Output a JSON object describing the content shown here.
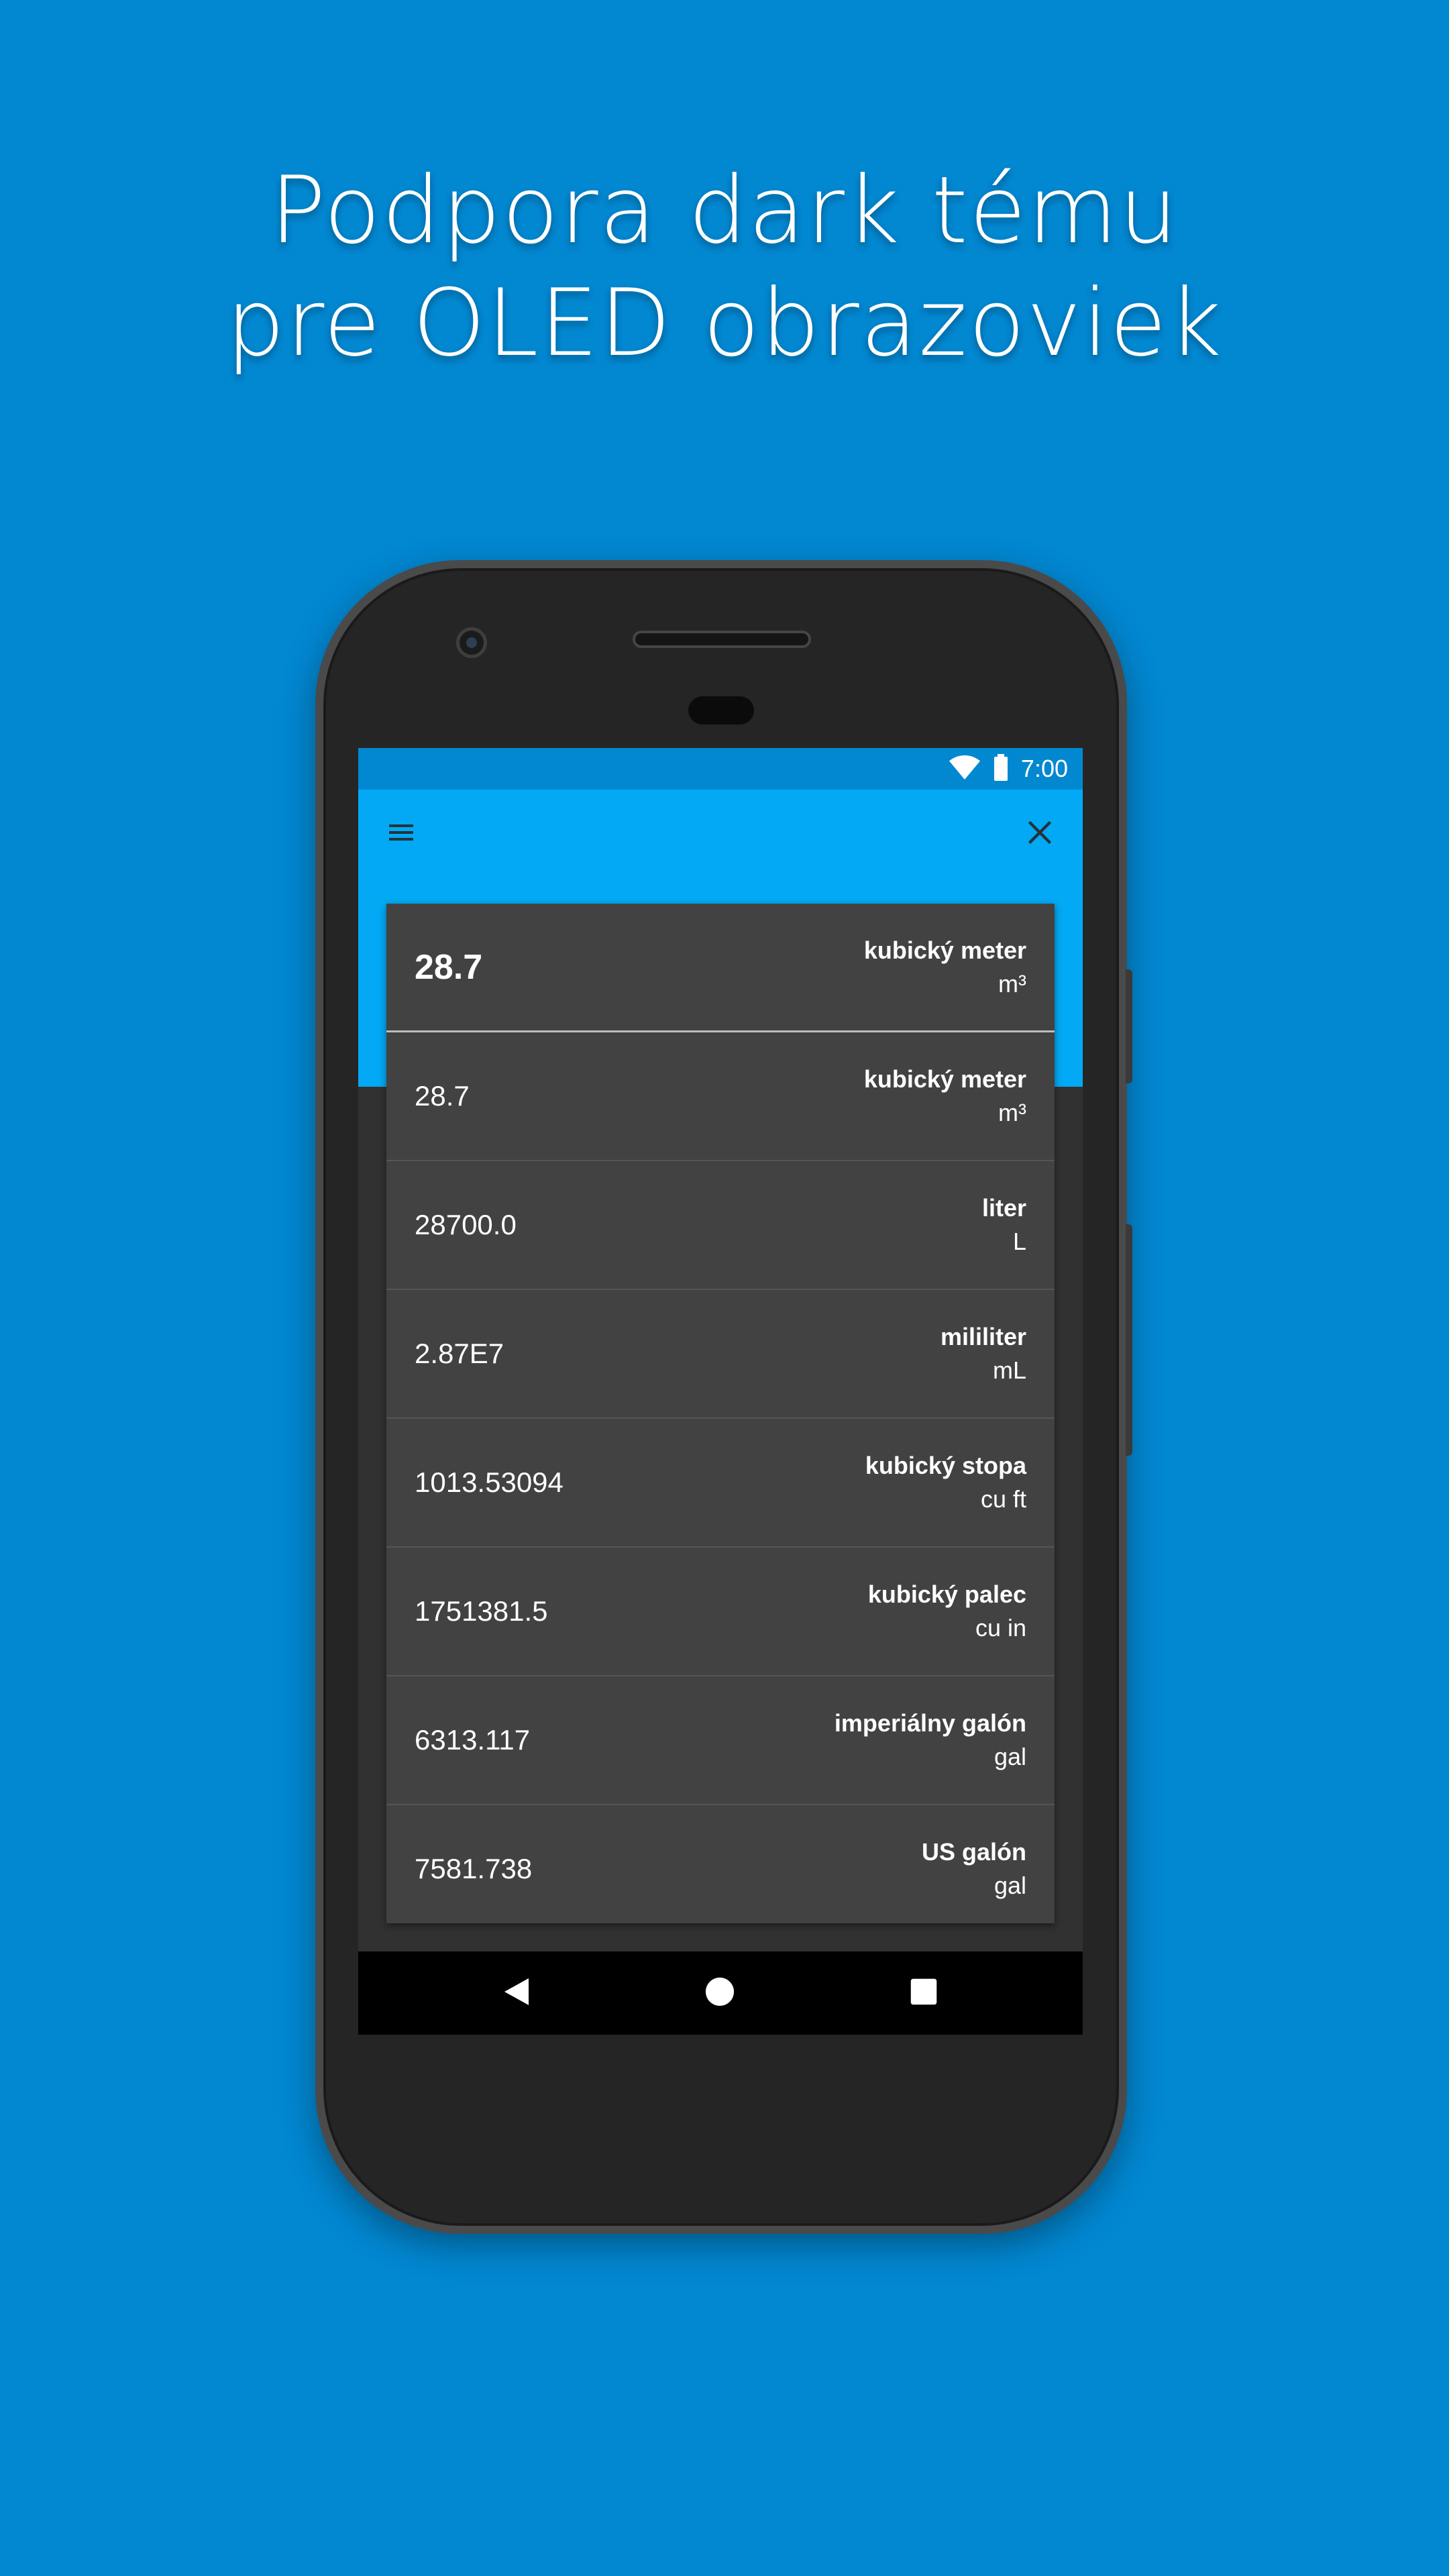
{
  "headline": {
    "line1": "Podpora dark tému",
    "line2": "pre OLED obrazoviek"
  },
  "status_bar": {
    "time": "7:00",
    "icons": [
      "wifi-icon",
      "battery-icon"
    ]
  },
  "toolbar": {
    "menu_icon": "menu-icon",
    "close_icon": "close-icon"
  },
  "input": {
    "value": "28.7",
    "unit_name": "kubický meter",
    "unit_symbol": "m³"
  },
  "results": [
    {
      "value": "28.7",
      "unit_name": "kubický meter",
      "unit_symbol": "m³"
    },
    {
      "value": "28700.0",
      "unit_name": "liter",
      "unit_symbol": "L"
    },
    {
      "value": "2.87E7",
      "unit_name": "mililiter",
      "unit_symbol": "mL"
    },
    {
      "value": "1013.53094",
      "unit_name": "kubický stopa",
      "unit_symbol": "cu ft"
    },
    {
      "value": "1751381.5",
      "unit_name": "kubický palec",
      "unit_symbol": "cu in"
    },
    {
      "value": "6313.117",
      "unit_name": "imperiálny galón",
      "unit_symbol": "gal"
    },
    {
      "value": "7581.738",
      "unit_name": "US galón",
      "unit_symbol": "gal"
    }
  ],
  "nav_bar": {
    "back_icon": "back-icon",
    "home_icon": "home-icon",
    "recents_icon": "recents-icon"
  },
  "colors": {
    "background": "#0287d1",
    "status_bar": "#0288d1",
    "app_bar": "#03a9f4",
    "card": "#424242",
    "screen": "#313131"
  }
}
